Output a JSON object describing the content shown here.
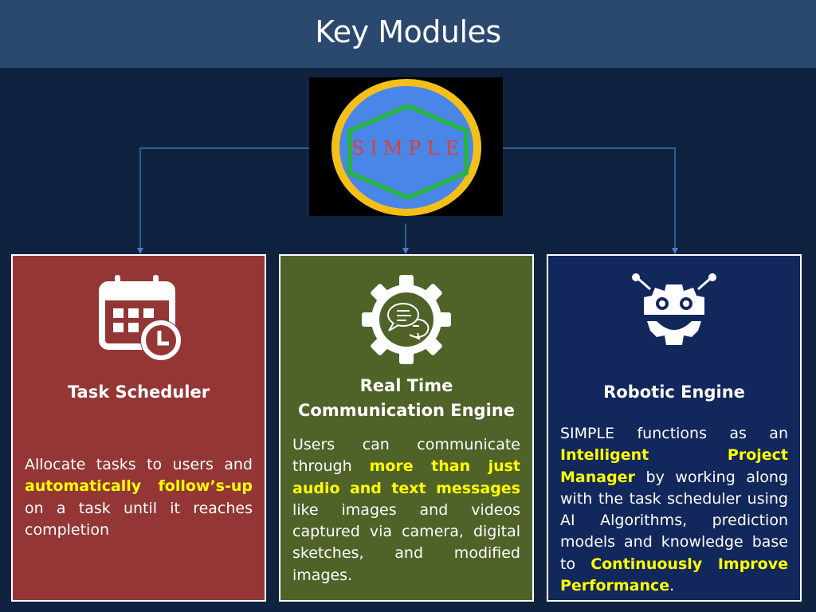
{
  "header": {
    "title": "Key Modules"
  },
  "logo": {
    "text": "SIMPLE",
    "colors": {
      "ring": "#f4c018",
      "fill": "#4a86e8",
      "hexagon": "#27b24a",
      "text": "#d9413a"
    }
  },
  "modules": [
    {
      "title": "Task Scheduler",
      "icon": "calendar-clock-icon",
      "color": "#933635",
      "description": [
        {
          "text": "Allocate tasks to users and ",
          "highlight": false
        },
        {
          "text": "automatically follow’s-up",
          "highlight": true
        },
        {
          "text": " on a task until it reaches completion",
          "highlight": false
        }
      ]
    },
    {
      "title": "Real Time Communication Engine",
      "icon": "gear-chat-icon",
      "color": "#4f6228",
      "description": [
        {
          "text": "Users can communicate through ",
          "highlight": false
        },
        {
          "text": "more than just audio and text messages",
          "highlight": true
        },
        {
          "text": " like images and videos captured via camera, digital sketches, and modified images.",
          "highlight": false
        }
      ]
    },
    {
      "title": "Robotic Engine",
      "icon": "robot-gear-icon",
      "color": "#12275b",
      "description": [
        {
          "text": "SIMPLE functions as an ",
          "highlight": false
        },
        {
          "text": "Intelligent Project Manager",
          "highlight": true
        },
        {
          "text": " by working along with the task scheduler using AI Algorithms, prediction models and knowledge base to ",
          "highlight": false
        },
        {
          "text": "Continuously Improve Performance",
          "highlight": true
        },
        {
          "text": ".",
          "highlight": false
        }
      ]
    }
  ],
  "highlight_color": "#ffff00",
  "connector_color": "#4a7ec8"
}
